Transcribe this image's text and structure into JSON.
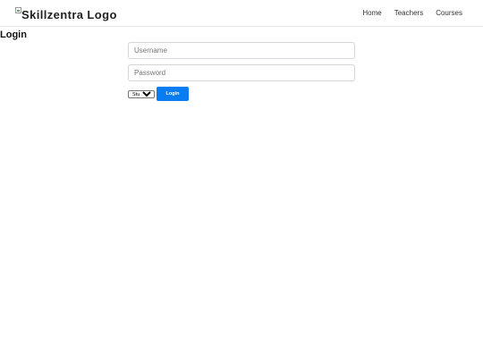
{
  "header": {
    "logo_text": "Skillzentra Logo",
    "nav": [
      {
        "label": "Home"
      },
      {
        "label": "Teachers"
      },
      {
        "label": "Courses"
      }
    ]
  },
  "main": {
    "title": "Login",
    "username_placeholder": "Username",
    "username_value": "",
    "password_placeholder": "Password",
    "password_value": "",
    "role_selected": "Student",
    "login_label": "Login"
  },
  "colors": {
    "accent": "#0a7cf2",
    "border": "#d3d6da"
  },
  "icons": {
    "logo": "broken-image-icon"
  }
}
